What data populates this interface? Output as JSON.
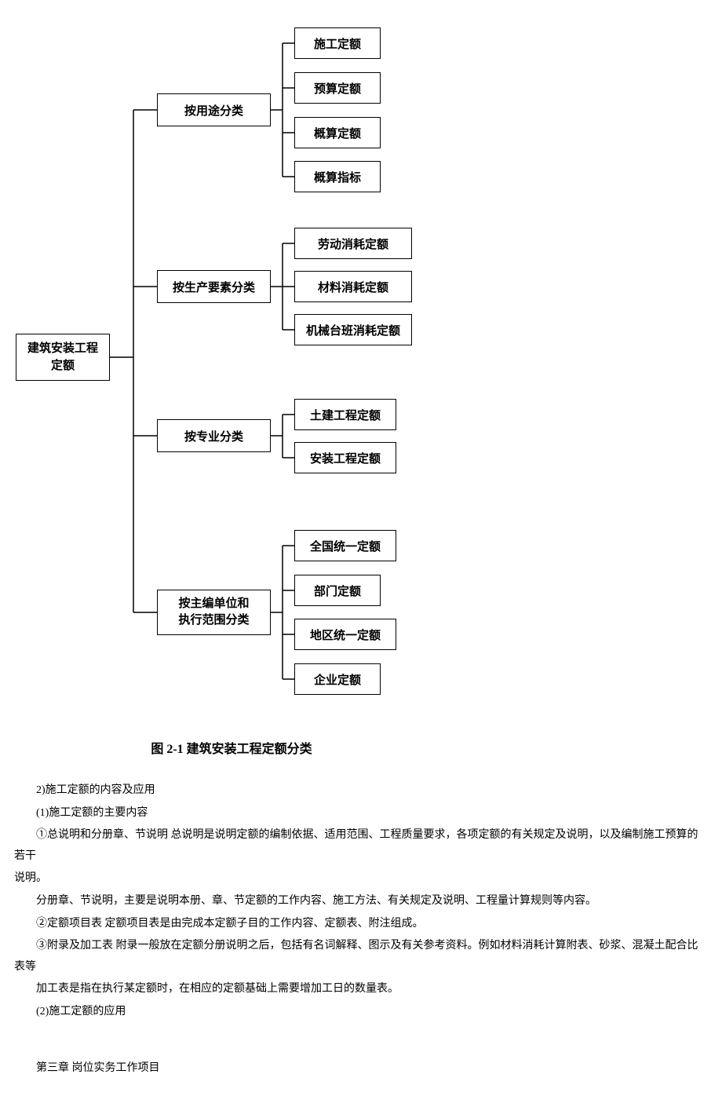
{
  "chart_data": {
    "type": "tree",
    "title": "图 2-1  建筑安装工程定额分类",
    "root": "建筑安装工程定额",
    "branches": [
      {
        "name": "按用途分类",
        "children": [
          "施工定额",
          "预算定额",
          "概算定额",
          "概算指标"
        ]
      },
      {
        "name": "按生产要素分类",
        "children": [
          "劳动消耗定额",
          "材料消耗定额",
          "机械台班消耗定额"
        ]
      },
      {
        "name": "按专业分类",
        "children": [
          "土建工程定额",
          "安装工程定额"
        ]
      },
      {
        "name": "按主编单位和执行范围分类",
        "children": [
          "全国统一定额",
          "部门定额",
          "地区统一定额",
          "企业定额"
        ]
      }
    ]
  },
  "diagram": {
    "root": "建筑安装工程\n定额",
    "b1": "按用途分类",
    "b1_leaves": [
      "施工定额",
      "预算定额",
      "概算定额",
      "概算指标"
    ],
    "b2": "按生产要素分类",
    "b2_leaves": [
      "劳动消耗定额",
      "材料消耗定额",
      "机械台班消耗定额"
    ],
    "b3": "按专业分类",
    "b3_leaves": [
      "土建工程定额",
      "安装工程定额"
    ],
    "b4": "按主编单位和\n执行范围分类",
    "b4_leaves": [
      "全国统一定额",
      "部门定额",
      "地区统一定额",
      "企业定额"
    ]
  },
  "caption": "图 2-1  建筑安装工程定额分类",
  "text": {
    "p1": "2)施工定额的内容及应用",
    "p2": "(1)施工定额的主要内容",
    "p3": "①总说明和分册章、节说明 总说明是说明定额的编制依据、适用范围、工程质量要求，各项定额的有关规定及说明，以及编制施工预算的若干",
    "p3b": "说明。",
    "p4": "分册章、节说明，主要是说明本册、章、节定额的工作内容、施工方法、有关规定及说明、工程量计算规则等内容。",
    "p5": "②定额项目表 定额项目表是由完成本定额子目的工作内容、定额表、附注组成。",
    "p6": "③附录及加工表 附录一般放在定额分册说明之后，包括有名词解释、图示及有关参考资料。例如材料消耗计算附表、砂浆、混凝土配合比表等",
    "p7": "加工表是指在执行某定额时，在相应的定额基础上需要增加工日的数量表。",
    "p8": "(2)施工定额的应用",
    "chapter": "第三章 岗位实务工作项目"
  }
}
